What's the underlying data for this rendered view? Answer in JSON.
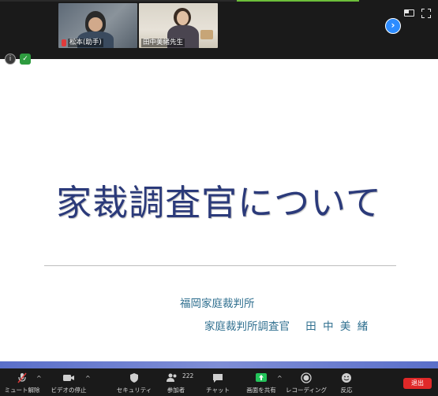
{
  "participants": [
    {
      "name": "松本(助手)",
      "muted": true
    },
    {
      "name": "田中美緒先生",
      "muted": false
    }
  ],
  "slide": {
    "title": "家裁調査官について",
    "court": "福岡家庭裁判所",
    "presenter_role": "家庭裁判所調査官",
    "presenter_name": [
      "田",
      "中",
      "美",
      "緒"
    ]
  },
  "toolbar": {
    "unmute_label": "ミュート解除",
    "stop_video_label": "ビデオの停止",
    "security_label": "セキュリティ",
    "participants_label": "参加者",
    "participants_count": "222",
    "chat_label": "チャット",
    "share_label": "画面を共有",
    "record_label": "レコーディング",
    "reactions_label": "反応",
    "leave_label": "退出"
  },
  "colors": {
    "accent_blue": "#2d8cff",
    "share_green": "#23c45a",
    "leave_red": "#e02828",
    "title_navy": "#2b3a7a",
    "subtitle_teal": "#2f6f8f"
  }
}
